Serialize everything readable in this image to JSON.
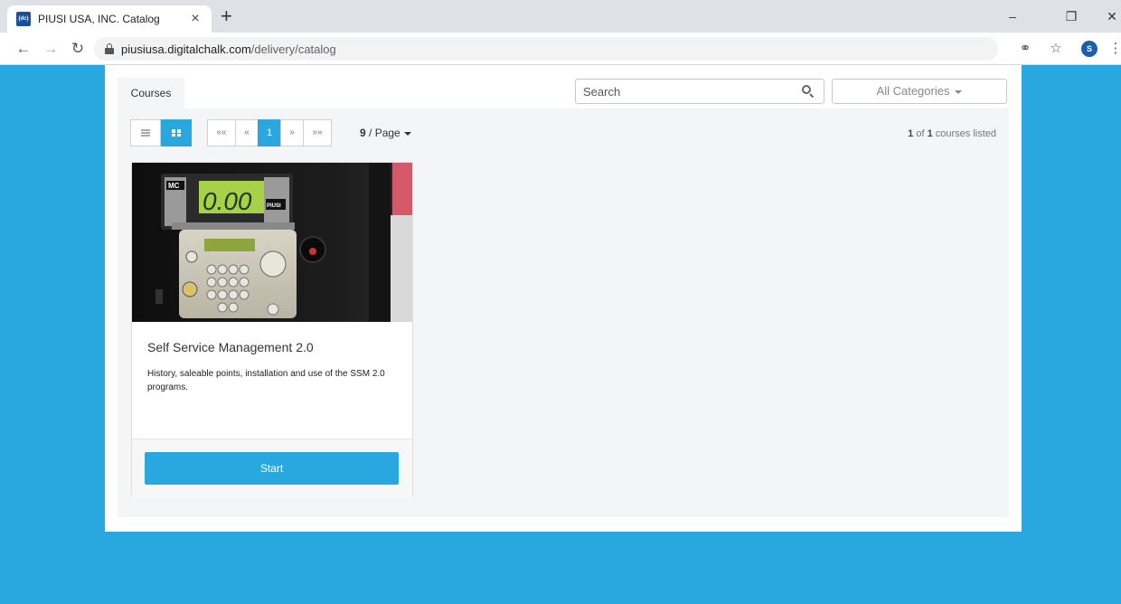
{
  "browser": {
    "tab_title": "PIUSI USA, INC. Catalog",
    "favicon_text": "(dc)",
    "tab_close": "×",
    "new_tab": "+",
    "url_host": "piusiusa.digitalchalk.com",
    "url_path": "/delivery/catalog",
    "profile_initial": "S",
    "icons": [
      "back-icon",
      "forward-icon",
      "reload-icon",
      "lock-icon",
      "key-icon",
      "star-icon",
      "menu-icon"
    ]
  },
  "header": {
    "courses_tab": "Courses",
    "search_placeholder": "Search",
    "category_label": "All Categories"
  },
  "pagination": {
    "first": "««",
    "prev": "«",
    "current": "1",
    "next": "»",
    "last": "»»",
    "per_page_count": "9",
    "per_page_suffix": " / Page",
    "count_current": "1",
    "count_of": " of ",
    "count_total": "1",
    "count_suffix": " courses listed"
  },
  "courses": [
    {
      "image_text": "0.00",
      "image_brand_left": "MC",
      "image_brand_right": "PIUSI",
      "title": "Self Service Management 2.0",
      "description": "History, saleable points, installation and use of the SSM 2.0 programs.",
      "action": "Start"
    }
  ],
  "colors": {
    "accent": "#29a8df",
    "panel": "#f4f5f7"
  }
}
